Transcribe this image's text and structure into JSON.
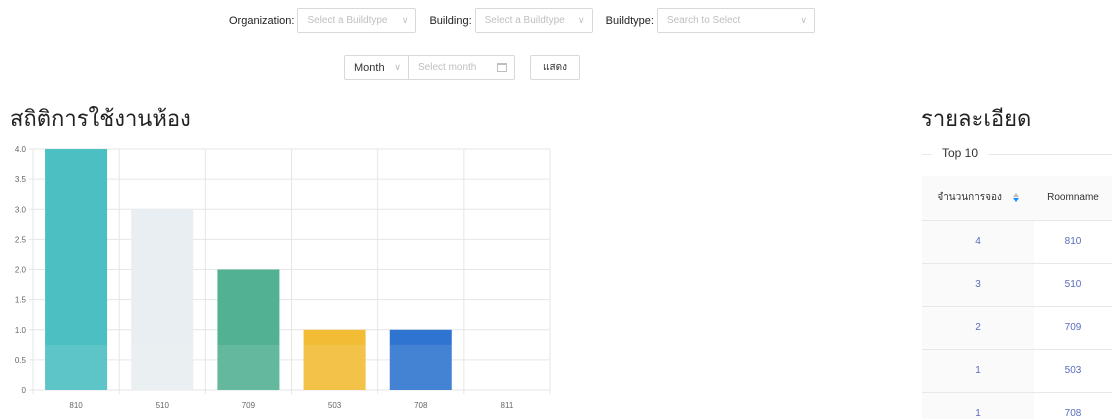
{
  "filters": {
    "organization_label": "Organization:",
    "organization_placeholder": "Select a Buildtype",
    "building_label": "Building:",
    "building_placeholder": "Select a Buildtype",
    "buildtype_label": "Buildtype:",
    "buildtype_placeholder": "Search to Select",
    "period_value": "Month",
    "date_placeholder": "Select month",
    "show_button": "แสดง"
  },
  "headings": {
    "chart_title": "สถิติการใช้งานห้อง",
    "detail_title": "รายละเอียด"
  },
  "chart_data": {
    "type": "bar",
    "categories": [
      "810",
      "510",
      "709",
      "503",
      "708",
      "811"
    ],
    "values": [
      4,
      3,
      2,
      1,
      1,
      0
    ],
    "colors": [
      "#4bbfc2",
      "#e8eef1",
      "#52b093",
      "#f2bc35",
      "#2f74d0",
      "#dddddd"
    ],
    "ylim": [
      0,
      4
    ],
    "yticks": [
      "0",
      "0.5",
      "1.0",
      "1.5",
      "2.0",
      "2.5",
      "3.0",
      "3.5",
      "4.0"
    ],
    "grid": true
  },
  "detail": {
    "top_label": "Top 10",
    "col_count": "จำนวนการจอง",
    "col_room": "Roomname",
    "rows": [
      {
        "count": "4",
        "room": "810"
      },
      {
        "count": "3",
        "room": "510"
      },
      {
        "count": "2",
        "room": "709"
      },
      {
        "count": "1",
        "room": "503"
      },
      {
        "count": "1",
        "room": "708"
      }
    ]
  },
  "icons": {
    "select_arrow": "chevron-down-icon",
    "calendar": "calendar-icon",
    "sort": "sort-icon"
  }
}
